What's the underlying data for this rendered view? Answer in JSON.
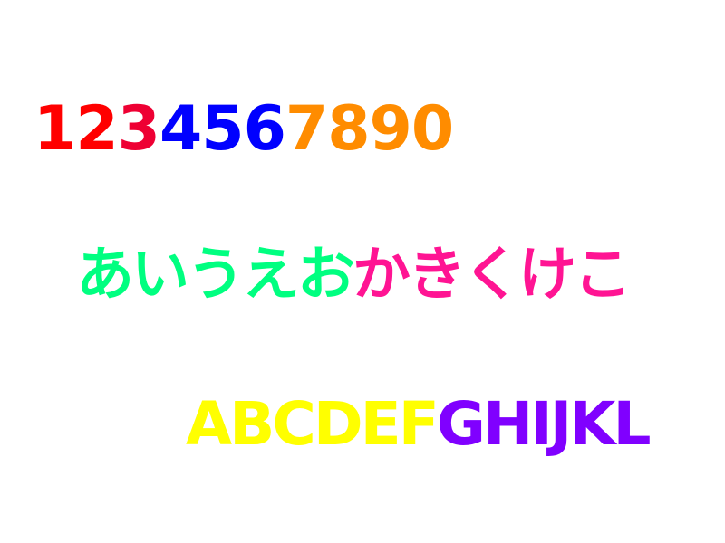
{
  "rows": [
    {
      "segments": [
        {
          "text": "12",
          "color": "#ff0000"
        },
        {
          "text": "3",
          "color": "#ee0033"
        },
        {
          "text": "456",
          "color": "#0000ff"
        },
        {
          "text": "7890",
          "color": "#ff8c00"
        }
      ]
    },
    {
      "segments": [
        {
          "text": "あいうえお",
          "color": "#00ff80"
        },
        {
          "text": "かきくけこ",
          "color": "#ff1493"
        }
      ]
    },
    {
      "segments": [
        {
          "text": "ABCDEF",
          "color": "#ffff00"
        },
        {
          "text": "GHIJKL",
          "color": "#8000ff"
        }
      ]
    }
  ]
}
